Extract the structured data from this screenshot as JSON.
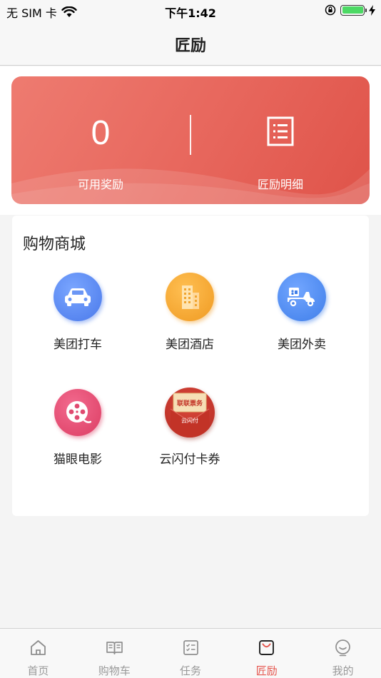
{
  "status_bar": {
    "carrier": "无 SIM 卡",
    "time": "下午1:42",
    "battery_level": 1.0
  },
  "nav": {
    "title": "匠励"
  },
  "reward": {
    "value": "0",
    "available_label": "可用奖励",
    "detail_label": "匠励明细"
  },
  "mall": {
    "title": "购物商城",
    "items": [
      {
        "label": "美团打车",
        "icon": "car-icon",
        "color": "#5a8cf2"
      },
      {
        "label": "美团酒店",
        "icon": "hotel-building-icon",
        "color": "#f2a22c"
      },
      {
        "label": "美团外卖",
        "icon": "delivery-scooter-icon",
        "color": "#4f8df0"
      },
      {
        "label": "猫眼电影",
        "icon": "film-reel-icon",
        "color": "#e4476e"
      },
      {
        "label": "云闪付卡券",
        "icon": "unionpay-coupon-icon",
        "color": "#c9392e",
        "badge_top": "联联票务",
        "badge_bottom": "云闪付"
      }
    ]
  },
  "tabs": [
    {
      "label": "首页",
      "icon": "home-icon"
    },
    {
      "label": "购物车",
      "icon": "book-icon"
    },
    {
      "label": "任务",
      "icon": "checklist-icon"
    },
    {
      "label": "匠励",
      "icon": "shopping-bag-icon",
      "active": true
    },
    {
      "label": "我的",
      "icon": "smiley-icon"
    }
  ],
  "colors": {
    "accent": "#e5554d",
    "tab_inactive": "#9a9a9a"
  }
}
